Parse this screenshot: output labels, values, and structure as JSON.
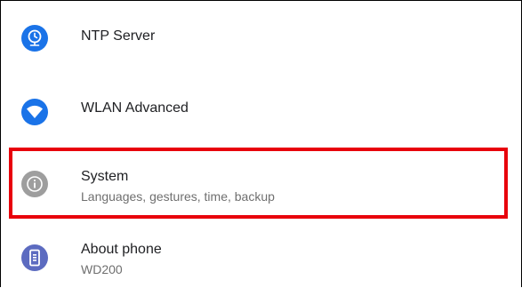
{
  "settings_list": {
    "items": [
      {
        "id": "ntp",
        "title": "NTP Server",
        "subtitle": "",
        "icon": "clock-icon",
        "icon_color": "#1a73e8"
      },
      {
        "id": "wlan",
        "title": "WLAN Advanced",
        "subtitle": "",
        "icon": "wifi-icon",
        "icon_color": "#1a73e8"
      },
      {
        "id": "system",
        "title": "System",
        "subtitle": "Languages, gestures, time, backup",
        "icon": "info-icon",
        "icon_color": "#9e9e9e"
      },
      {
        "id": "about",
        "title": "About phone",
        "subtitle": "WD200",
        "icon": "phone-icon",
        "icon_color": "#5c6bc0"
      }
    ]
  },
  "highlight": {
    "target": "system",
    "color": "#e8000b"
  }
}
